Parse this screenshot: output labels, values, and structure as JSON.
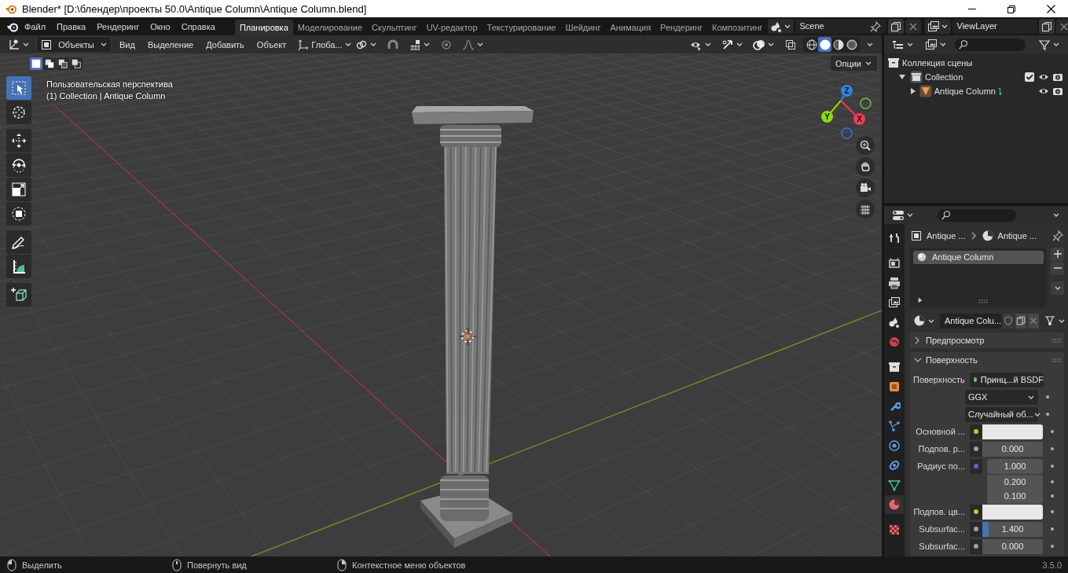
{
  "window": {
    "title": "Blender* [D:\\блендер\\проекты 50.0\\Antique Column\\Antique Column.blend]"
  },
  "menu": [
    "Файл",
    "Правка",
    "Рендеринг",
    "Окно",
    "Справка"
  ],
  "workspaces": [
    {
      "label": "Планировка",
      "selected": true
    },
    {
      "label": "Моделирование",
      "selected": false
    },
    {
      "label": "Скульптинг",
      "selected": false
    },
    {
      "label": "UV-редактор",
      "selected": false
    },
    {
      "label": "Текстурирование",
      "selected": false
    },
    {
      "label": "Шейдинг",
      "selected": false
    },
    {
      "label": "Анимация",
      "selected": false
    },
    {
      "label": "Рендеринг",
      "selected": false
    },
    {
      "label": "Композитинг",
      "selected": false
    }
  ],
  "scene": {
    "name": "Scene"
  },
  "view_layer": {
    "name": "ViewLayer"
  },
  "viewport": {
    "mode": "Объекты",
    "menus": [
      "Вид",
      "Выделение",
      "Добавить",
      "Объект"
    ],
    "orientation": "Глоба...",
    "options": "Опции",
    "view_name": "Пользовательская перспектива",
    "context": "(1) Collection | Antique Column",
    "select_modes": [
      {
        "selected": true
      },
      {
        "selected": false
      },
      {
        "selected": false
      },
      {
        "selected": false
      }
    ],
    "shading": [
      {
        "kind": "wireframe",
        "selected": false
      },
      {
        "kind": "solid",
        "selected": true
      },
      {
        "kind": "material",
        "selected": false
      },
      {
        "kind": "rendered",
        "selected": false
      }
    ],
    "tools": [
      {
        "kind": "select",
        "selected": true
      },
      {
        "kind": "cursor",
        "selected": false
      },
      {
        "kind": "move",
        "selected": false
      },
      {
        "kind": "rotate",
        "selected": false
      },
      {
        "kind": "scale",
        "selected": false
      },
      {
        "kind": "transform",
        "selected": false
      },
      {
        "kind": "annotate",
        "selected": false
      },
      {
        "kind": "measure",
        "selected": false
      },
      {
        "kind": "add",
        "selected": false
      }
    ],
    "gizmo": [
      {
        "kind": "negz",
        "color": "#2e69c9"
      },
      {
        "kind": "negy",
        "color": "#6ea044"
      },
      {
        "kind": "y",
        "label": "Y",
        "color": "#8bdc00"
      },
      {
        "kind": "x",
        "label": "X",
        "color": "#f53a54"
      },
      {
        "kind": "z",
        "label": "Z",
        "color": "#2f83e3"
      }
    ]
  },
  "outliner": {
    "items": [
      {
        "kind": "scene",
        "label": "Коллекция сцены",
        "children": [
          {
            "kind": "collection",
            "label": "Collection",
            "expanded": true,
            "checked": true,
            "visible": true,
            "renderable": true,
            "children": [
              {
                "kind": "mesh",
                "label": "Antique Column",
                "expanded": false,
                "visible": true,
                "renderable": true
              }
            ]
          }
        ]
      }
    ]
  },
  "properties": {
    "breadcrumb": [
      "Antique ...",
      "Antique ..."
    ],
    "tabs": [
      {
        "kind": "tool",
        "selected": false
      },
      {
        "kind": "render",
        "selected": false
      },
      {
        "kind": "output",
        "selected": false
      },
      {
        "kind": "viewlayer",
        "selected": false
      },
      {
        "kind": "scene",
        "selected": false
      },
      {
        "kind": "world",
        "selected": false
      },
      {
        "kind": "collection",
        "selected": false
      },
      {
        "kind": "object",
        "selected": false
      },
      {
        "kind": "modifier",
        "selected": false
      },
      {
        "kind": "particles",
        "selected": false
      },
      {
        "kind": "physics",
        "selected": false
      },
      {
        "kind": "constraints",
        "selected": false
      },
      {
        "kind": "data",
        "selected": false
      },
      {
        "kind": "material",
        "selected": true
      },
      {
        "kind": "texture",
        "selected": false
      }
    ],
    "slots": [
      {
        "name": "Antique Column",
        "selected": true
      }
    ],
    "material": "Antique Colu...",
    "panels": [
      {
        "title": "Предпросмотр",
        "expanded": false
      },
      {
        "title": "Поверхность",
        "expanded": true
      }
    ],
    "rows": [
      {
        "kind": "link",
        "label": "Поверхность",
        "value": "Принц...й BSDF",
        "socket": {
          "color": "#63c763"
        }
      },
      {
        "kind": "menu",
        "value": "GGX"
      },
      {
        "kind": "menu",
        "value": "Случайный об..."
      },
      {
        "kind": "swatch",
        "label": "Основной ...",
        "socket": {
          "color": "#c7c729"
        },
        "color": "#e8e8e8"
      },
      {
        "kind": "number",
        "label": "Подпов. р...",
        "value": "0.000",
        "socket": {
          "color": "#a1a1a1"
        }
      },
      {
        "kind": "vector",
        "label": "Радиус по...",
        "values": [
          "1.000",
          "0.200",
          "0.100"
        ],
        "socket": {
          "color": "#6363c7"
        }
      },
      {
        "kind": "swatch",
        "label": "Подпов. цв...",
        "socket": {
          "color": "#c7c729"
        },
        "color": "#e8e8e8"
      },
      {
        "kind": "slider",
        "label": "Subsurfac...",
        "value": "1.400",
        "level": 0.1,
        "socket": {
          "color": "#a1a1a1"
        }
      },
      {
        "kind": "number",
        "label": "Subsurfac...",
        "value": "0.000",
        "socket": {
          "color": "#a1a1a1"
        }
      }
    ]
  },
  "status_bar": {
    "hints": [
      "Выделить",
      "Повернуть вид",
      "Контекстное меню объектов"
    ],
    "version": "3.5.0"
  }
}
